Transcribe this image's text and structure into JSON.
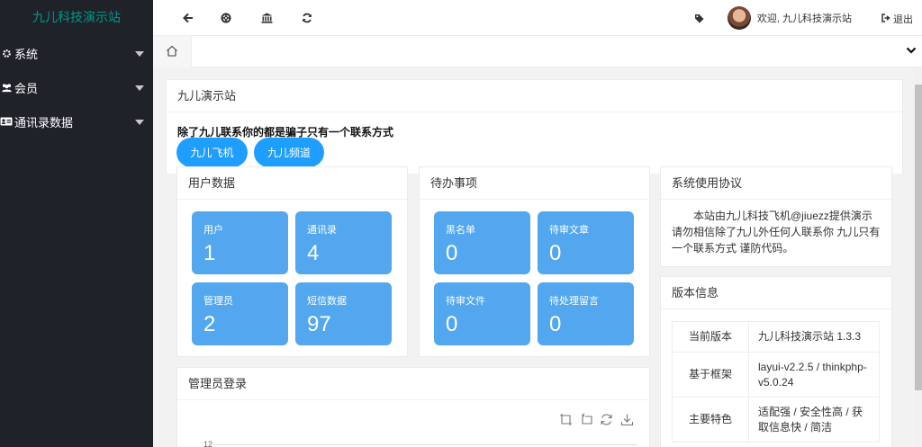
{
  "app": {
    "title": "九儿科技演示站"
  },
  "sidebar": {
    "items": [
      {
        "label": "系统",
        "icon": "gear-icon"
      },
      {
        "label": "会员",
        "icon": "users-icon"
      },
      {
        "label": "通讯录数据",
        "icon": "id-card-icon"
      }
    ]
  },
  "header": {
    "icons": [
      "back-arrow-icon",
      "life-ring-icon",
      "bank-icon",
      "refresh-icon",
      "tag-icon"
    ],
    "welcome": "欢迎, 九儿科技演示站",
    "logout": "退出"
  },
  "main": {
    "site_card": {
      "title": "九儿演示站",
      "notice": "除了九儿联系你的都是骗子只有一个联系方式",
      "buttons": [
        "九儿飞机",
        "九儿频道"
      ]
    },
    "user_data": {
      "title": "用户数据",
      "tiles": [
        {
          "label": "用户",
          "value": "1"
        },
        {
          "label": "通讯录",
          "value": "4"
        },
        {
          "label": "管理员",
          "value": "2"
        },
        {
          "label": "短信数据",
          "value": "97"
        }
      ]
    },
    "todo": {
      "title": "待办事项",
      "tiles": [
        {
          "label": "黑名单",
          "value": "0"
        },
        {
          "label": "待审文章",
          "value": "0"
        },
        {
          "label": "待审文件",
          "value": "0"
        },
        {
          "label": "待处理留言",
          "value": "0"
        }
      ]
    },
    "agreement": {
      "title": "系统使用协议",
      "text": "本站由九儿科技飞机@jiuezz提供演示 请勿相信除了九儿外任何人联系你 九儿只有一个联系方式 谨防代码。"
    },
    "version": {
      "title": "版本信息",
      "rows": [
        {
          "key": "当前版本",
          "value": "九儿科技演示站 1.3.3"
        },
        {
          "key": "基于框架",
          "value": "layui-v2.2.5 / thinkphp-v5.0.24"
        },
        {
          "key": "主要特色",
          "value": "适配强 / 安全性高 / 获取信息快 / 简洁"
        }
      ]
    },
    "admin_login": {
      "title": "管理员登录",
      "y_tick": "12",
      "tools": [
        "zoom-icon",
        "zoom-reset-icon",
        "restore-icon",
        "download-icon"
      ]
    }
  },
  "colors": {
    "sidebar_bg": "#20222a",
    "logo": "#009688",
    "button": "#1e9fff",
    "tile": "#52a7ef"
  }
}
